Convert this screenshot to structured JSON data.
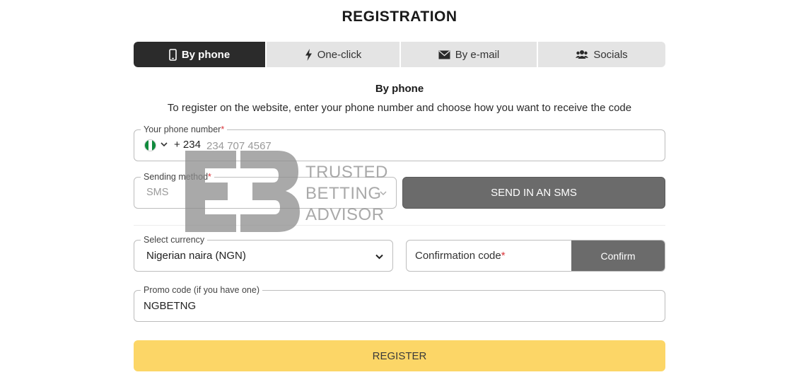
{
  "page": {
    "title": "REGISTRATION"
  },
  "tabs": [
    {
      "label": "By phone",
      "icon": "phone-icon",
      "active": true
    },
    {
      "label": "One-click",
      "icon": "lightning-icon",
      "active": false
    },
    {
      "label": "By e-mail",
      "icon": "envelope-icon",
      "active": false
    },
    {
      "label": "Socials",
      "icon": "users-icon",
      "active": false
    }
  ],
  "form": {
    "heading": "By phone",
    "description": "To register on the website, enter your phone number and choose how you want to receive the code",
    "phone": {
      "label": "Your phone number",
      "required_mark": "*",
      "country_flag": "nigeria-flag-icon",
      "dial_code": "+ 234",
      "placeholder": "234 707 4567"
    },
    "sending_method": {
      "label": "Sending method",
      "required_mark": "*",
      "value": "SMS"
    },
    "send_button": "SEND IN AN SMS",
    "currency": {
      "label": "Select currency",
      "value": "Nigerian naira (NGN)"
    },
    "confirmation": {
      "placeholder": "Confirmation code",
      "required_mark": "*",
      "button": "Confirm"
    },
    "promo": {
      "label": "Promo code (if you have one)",
      "value": "NGBETNG"
    },
    "register_button": "REGISTER"
  },
  "watermark": {
    "lines": [
      "TRUSTED",
      "BETTING",
      "ADVISOR"
    ]
  },
  "colors": {
    "active_tab": "#2b2b2b",
    "tab_bg": "#e4e4e4",
    "button_gray": "#6b6b6b",
    "register_yellow": "#fcd667",
    "required_red": "#d9353a",
    "flag_green": "#0f8a3c"
  }
}
